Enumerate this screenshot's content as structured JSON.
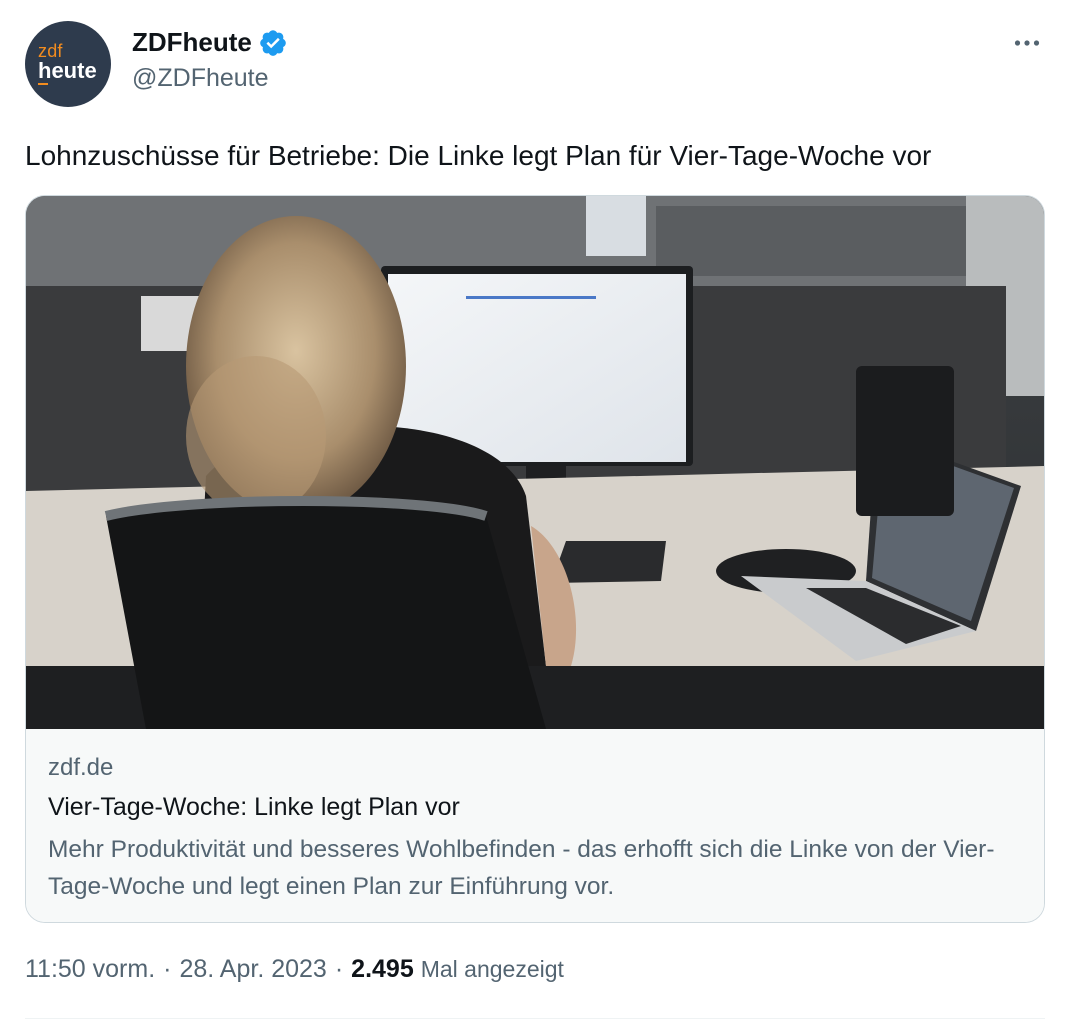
{
  "author": {
    "avatar_line1": "zdf",
    "avatar_line2": "heute",
    "display_name": "ZDFheute",
    "handle": "@ZDFheute",
    "verified": true,
    "verified_color": "#1d9bf0"
  },
  "more_icon": "more-horizontal-icon",
  "tweet_text": "Lohnzuschüsse für Betriebe: Die Linke legt Plan für Vier-Tage-Woche vor",
  "card": {
    "image_alt": "Frau am Schreibtisch im Büro vor Monitor und Laptop",
    "domain": "zdf.de",
    "title": "Vier-Tage-Woche: Linke legt Plan vor",
    "description": "Mehr Produktivität und besseres Wohlbefinden - das erhofft sich die Linke von der Vier-Tage-Woche und legt einen Plan zur Einführung vor."
  },
  "meta": {
    "time": "11:50 vorm.",
    "date": "28. Apr. 2023",
    "views_count": "2.495",
    "views_label": "Mal angezeigt"
  },
  "colors": {
    "text_primary": "#0f1419",
    "text_secondary": "#536471",
    "avatar_bg": "#2e3b4d",
    "avatar_accent": "#f28c1f",
    "card_border": "#cfd9de"
  }
}
